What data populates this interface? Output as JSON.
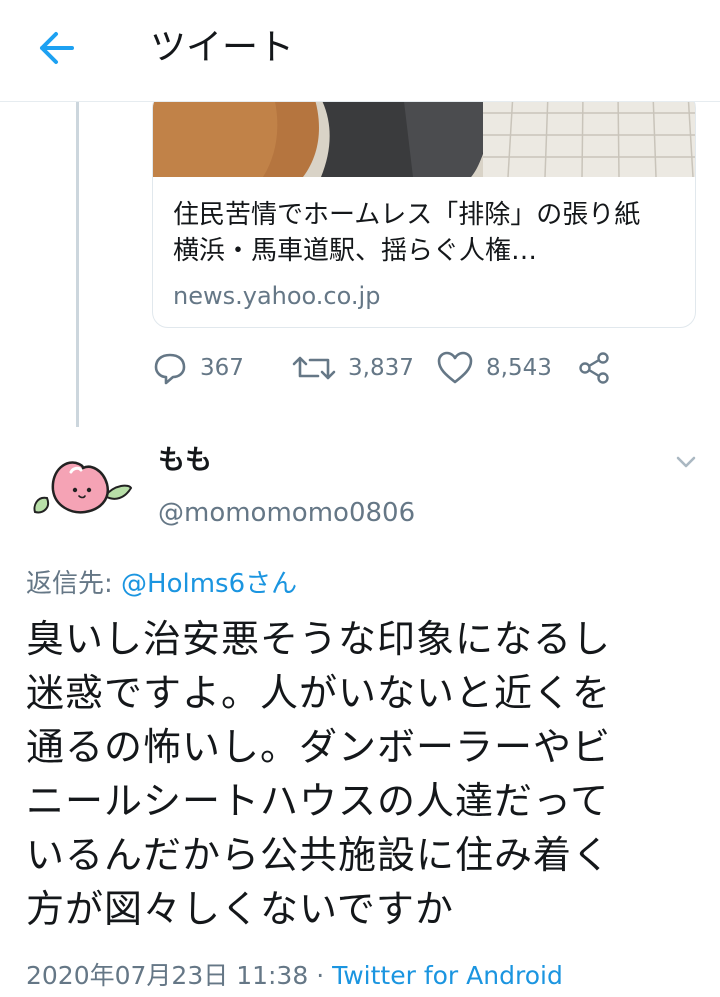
{
  "header": {
    "title": "ツイート",
    "back_icon": "arrow-left-icon",
    "accent": "#1da1f2"
  },
  "link_card": {
    "title": "住民苦情でホームレス「排除」の張り紙　横浜・馬車道駅、揺らぐ人権…",
    "domain": "news.yahoo.co.jp"
  },
  "actions": {
    "reply_count": "367",
    "retweet_count": "3,837",
    "like_count": "8,543",
    "icons": [
      "reply-icon",
      "retweet-icon",
      "like-icon",
      "share-icon"
    ]
  },
  "tweet": {
    "name": "もも",
    "handle": "@momomomo0806",
    "reply_label": "返信先: ",
    "reply_mention": "@Holms6さん",
    "text": "臭いし治安悪そうな印象になるし\n迷惑ですよ。人がいないと近くを\n通るの怖いし。ダンボーラーやビ\nニールシートハウスの人達だって\nいるんだから公共施設に住み着く\n方が図々しくないですか",
    "timestamp": "2020年07月23日 11:38",
    "separator": " · ",
    "source": "Twitter for Android",
    "colors": {
      "link": "#1b95e0",
      "secondary": "#657786",
      "text": "#14171a"
    }
  }
}
